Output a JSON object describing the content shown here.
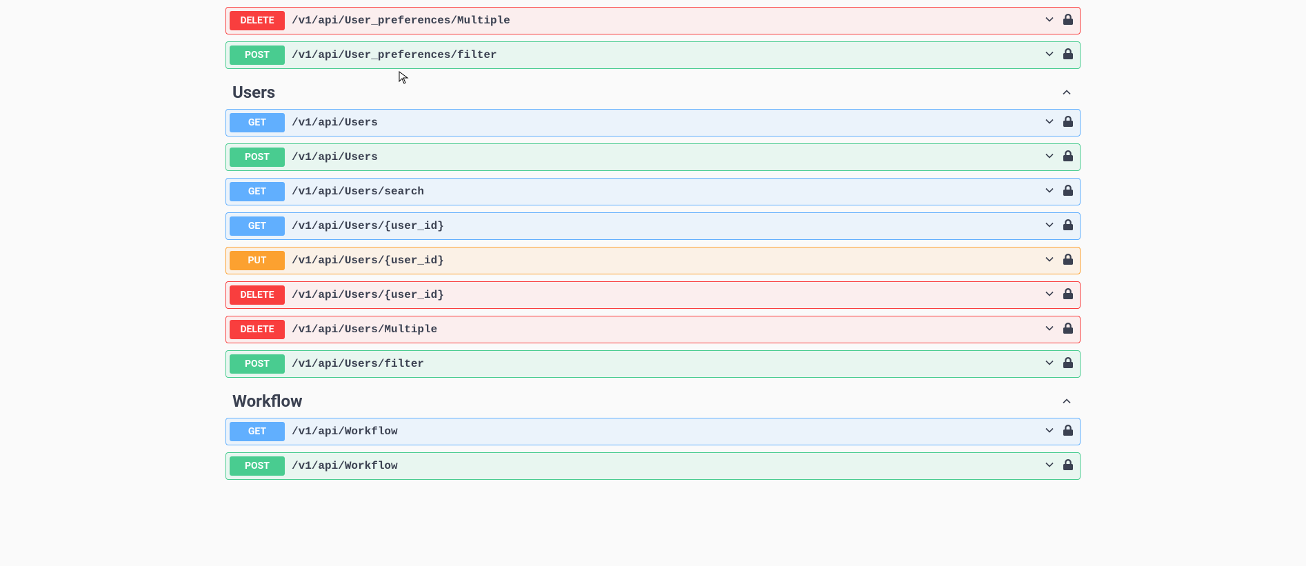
{
  "orphan_endpoints": [
    {
      "method": "DELETE",
      "path": "/v1/api/User_preferences/Multiple"
    },
    {
      "method": "POST",
      "path": "/v1/api/User_preferences/filter"
    }
  ],
  "sections": [
    {
      "title": "Users",
      "endpoints": [
        {
          "method": "GET",
          "path": "/v1/api/Users"
        },
        {
          "method": "POST",
          "path": "/v1/api/Users"
        },
        {
          "method": "GET",
          "path": "/v1/api/Users/search"
        },
        {
          "method": "GET",
          "path": "/v1/api/Users/{user_id}"
        },
        {
          "method": "PUT",
          "path": "/v1/api/Users/{user_id}"
        },
        {
          "method": "DELETE",
          "path": "/v1/api/Users/{user_id}"
        },
        {
          "method": "DELETE",
          "path": "/v1/api/Users/Multiple"
        },
        {
          "method": "POST",
          "path": "/v1/api/Users/filter"
        }
      ]
    },
    {
      "title": "Workflow",
      "endpoints": [
        {
          "method": "GET",
          "path": "/v1/api/Workflow"
        },
        {
          "method": "POST",
          "path": "/v1/api/Workflow"
        }
      ]
    }
  ]
}
